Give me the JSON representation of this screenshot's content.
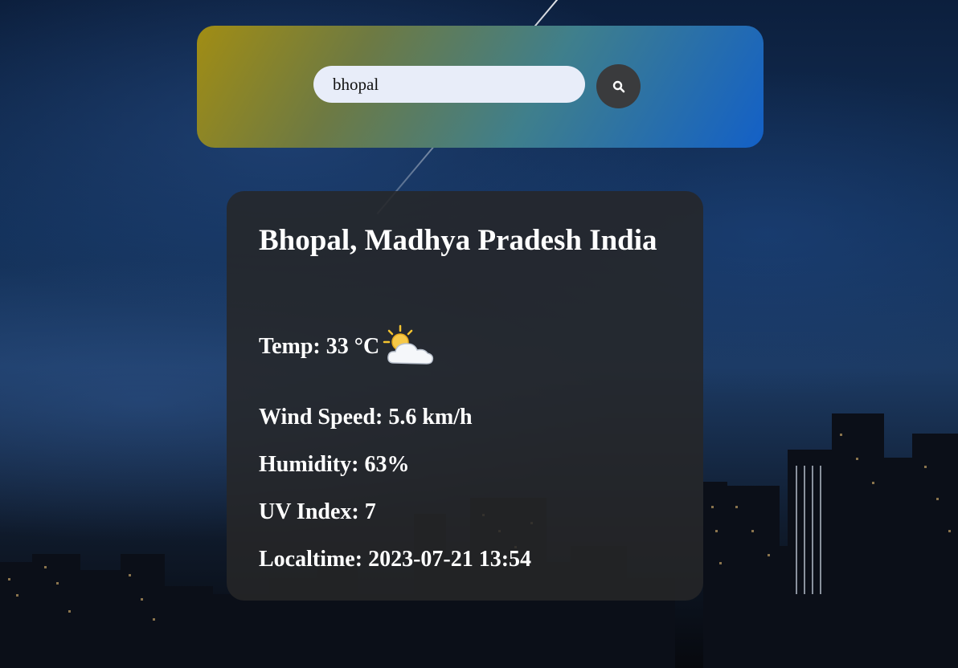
{
  "search": {
    "value": "bhopal",
    "button_icon": "search-icon"
  },
  "weather": {
    "location": "Bhopal, Madhya Pradesh India",
    "temp_label": "Temp: 33 °C",
    "condition_icon": "partly-cloudy-icon",
    "wind_label": "Wind Speed: 5.6 km/h",
    "humidity_label": "Humidity: 63%",
    "uv_label": "UV Index: 7",
    "localtime_label": "Localtime: 2023-07-21 13:54"
  },
  "colors": {
    "search_panel_start": "#a18d14",
    "search_panel_end": "#1360c7",
    "input_bg": "#e8edf9",
    "button_bg": "#3a3b3d",
    "card_bg": "#262628"
  }
}
